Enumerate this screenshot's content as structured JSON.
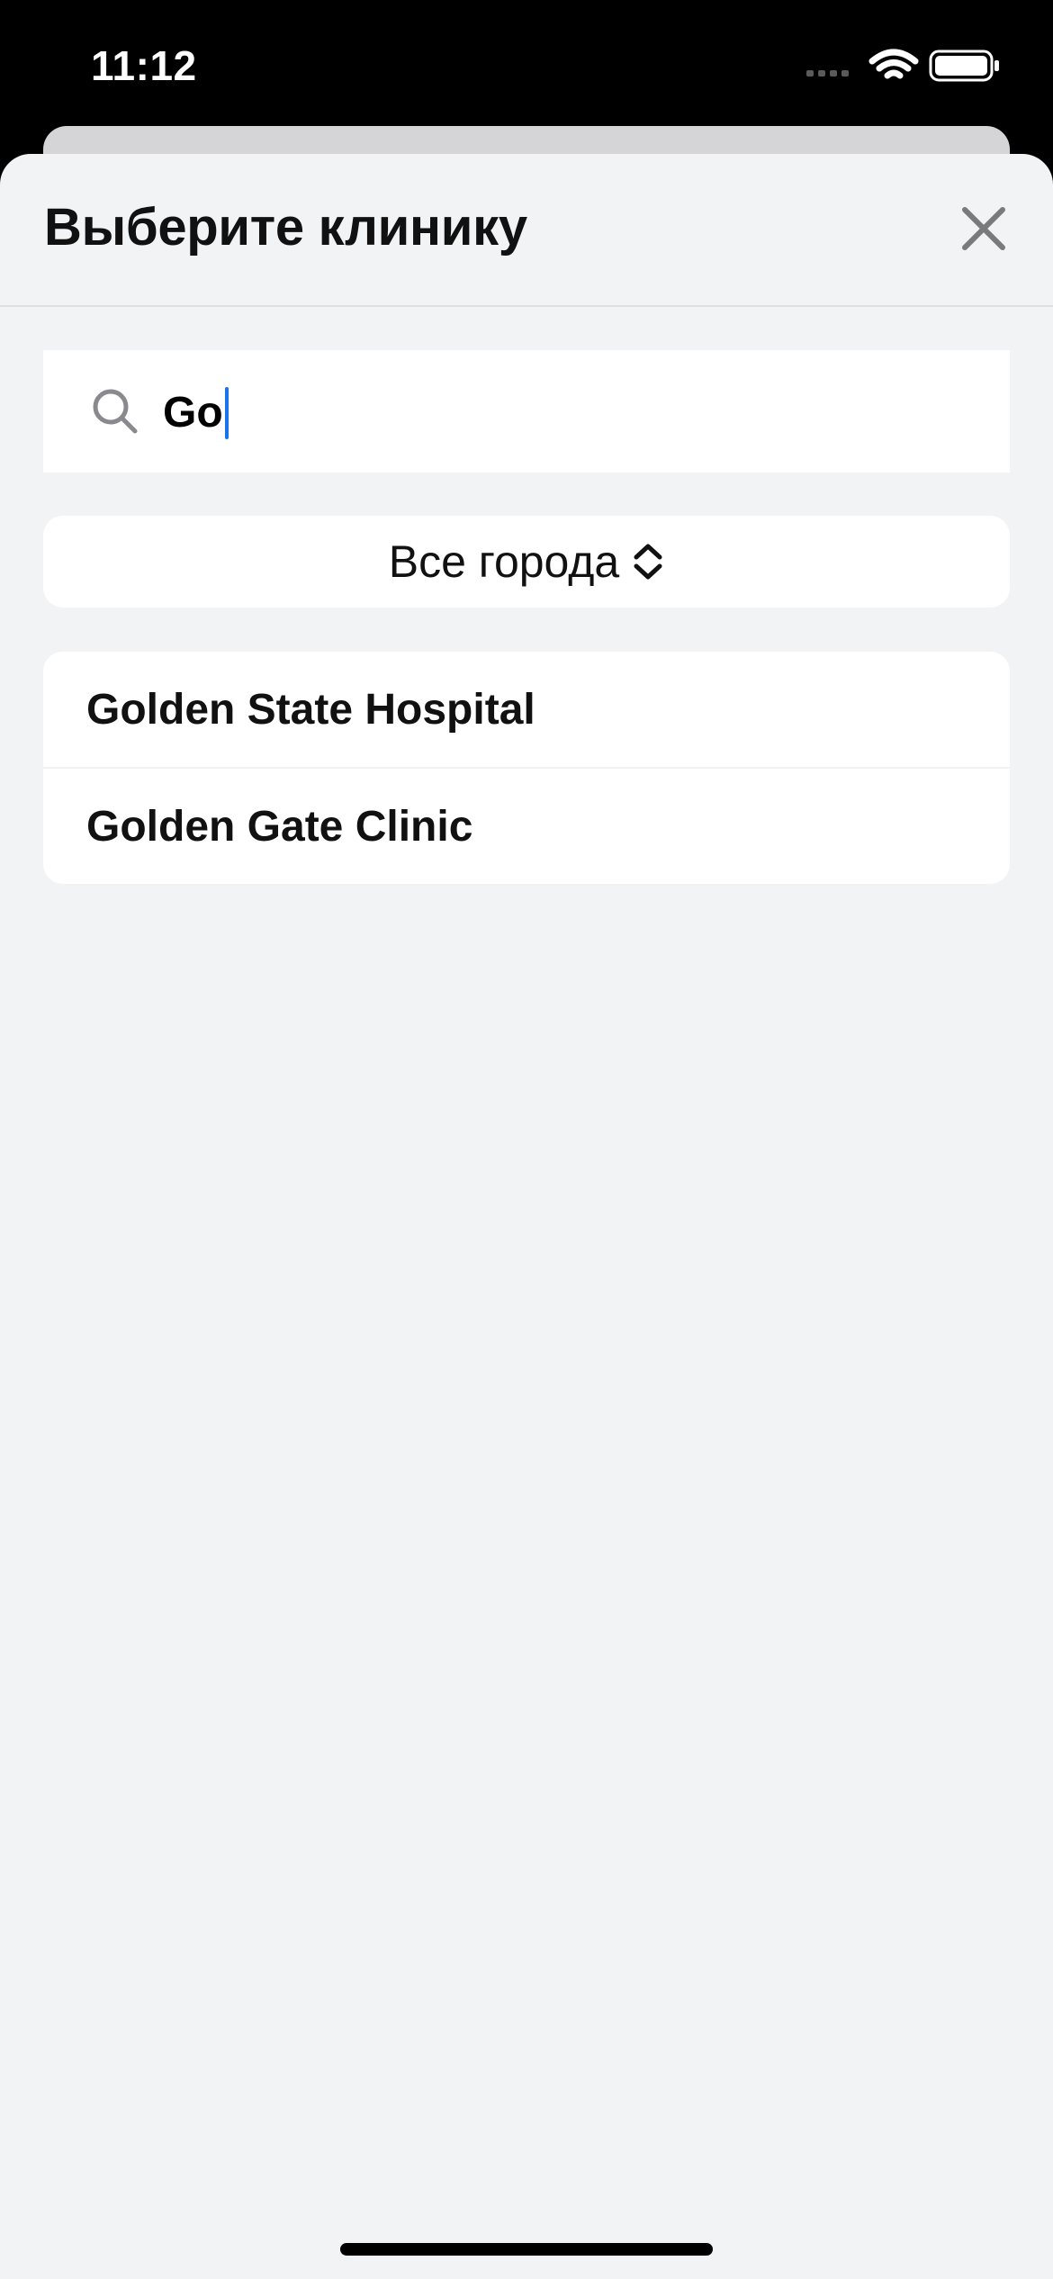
{
  "status_bar": {
    "time": "11:12",
    "icons": [
      "cellular-signal-icon",
      "wifi-icon",
      "battery-icon"
    ]
  },
  "sheet": {
    "title": "Выберите клинику",
    "close_icon": "close-icon"
  },
  "search": {
    "icon": "search-icon",
    "value": "Go"
  },
  "city_filter": {
    "label": "Все города",
    "icon": "chevron-updown-icon"
  },
  "results": [
    {
      "label": "Golden State Hospital"
    },
    {
      "label": "Golden Gate Clinic"
    }
  ],
  "colors": {
    "sheet_background": "#f2f3f5",
    "card_background": "#ffffff",
    "caret": "#1a73e8",
    "status_bar": "#000000"
  }
}
